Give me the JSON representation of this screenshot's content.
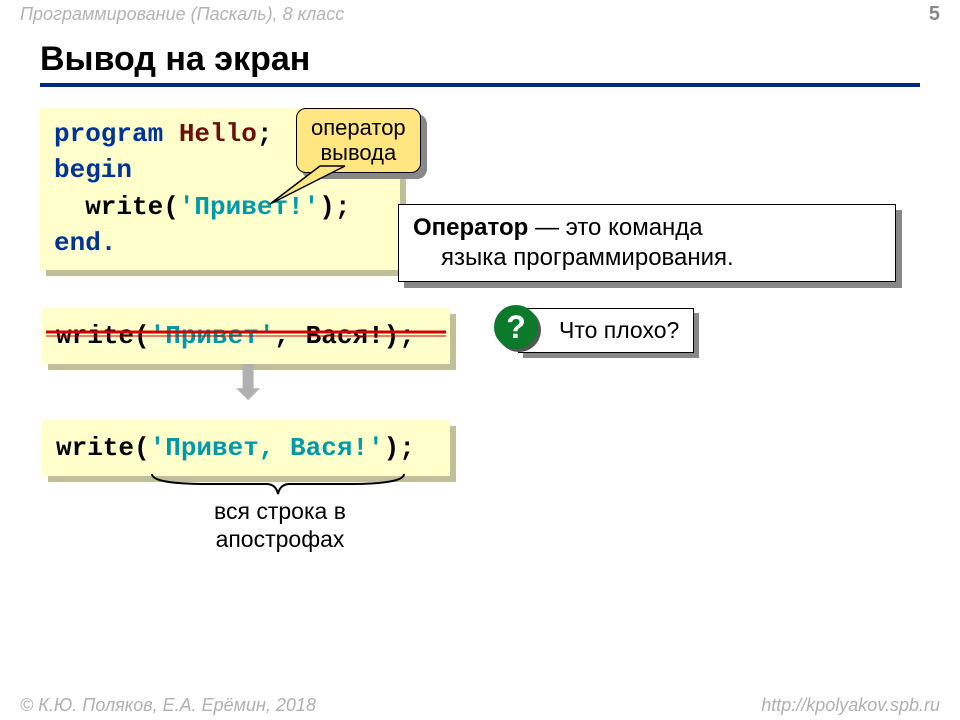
{
  "header": {
    "course": "Программирование (Паскаль), 8 класс",
    "page": "5"
  },
  "footer": {
    "authors": "© К.Ю. Поляков, Е.А. Ерёмин, 2018",
    "url": "http://kpolyakov.spb.ru"
  },
  "title": "Вывод на экран",
  "code1": {
    "l1a": "program",
    "l1b": " Hello",
    "l1c": ";",
    "l2": "begin",
    "l3a": "  write(",
    "l3b": "'Привет!'",
    "l3c": ");",
    "l4": "end."
  },
  "callout1": {
    "l1": "оператор",
    "l2": "вывода"
  },
  "infobox": {
    "t1": "Оператор",
    "t2": " — это команда",
    "t3": "языка программирования."
  },
  "code2": {
    "a": "write(",
    "b": "'Привет'",
    "c": ", Вася!);"
  },
  "question": {
    "mark": "?",
    "text": "Что плохо?"
  },
  "code3": {
    "a": "write(",
    "b": "'Привет, Вася!'",
    "c": ");"
  },
  "caption": {
    "l1": "вся строка в",
    "l2": "апострофах"
  }
}
